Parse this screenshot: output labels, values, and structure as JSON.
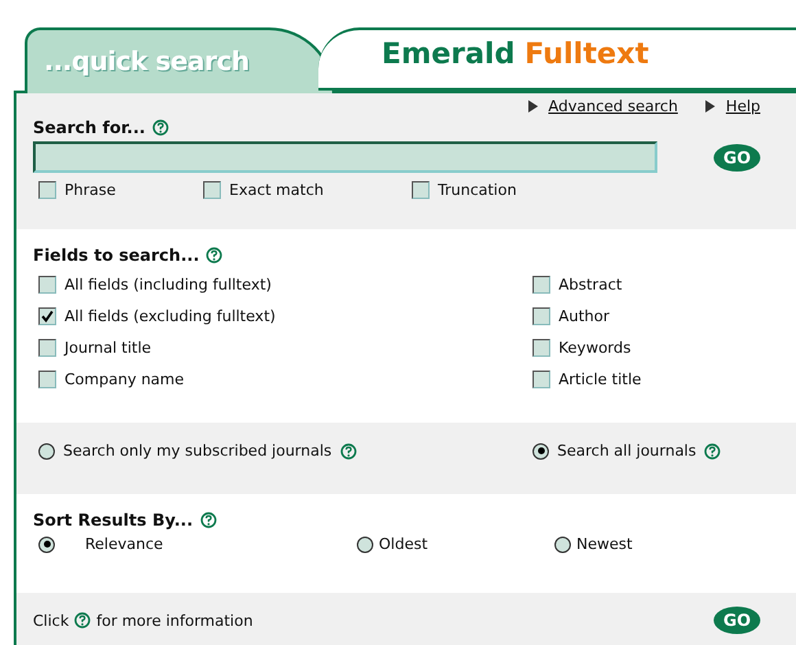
{
  "header": {
    "tab": "...quick search",
    "brand": [
      "Emerald",
      "Fulltext"
    ]
  },
  "links": [
    "Advanced search",
    "Help"
  ],
  "search": {
    "label": "Search for...",
    "go": "GO",
    "options": [
      {
        "label": "Phrase",
        "checked": false
      },
      {
        "label": "Exact match",
        "checked": false
      },
      {
        "label": "Truncation",
        "checked": false
      }
    ]
  },
  "fields": {
    "label": "Fields to search...",
    "left": [
      {
        "label": "All fields (including fulltext)",
        "checked": false
      },
      {
        "label": "All fields (excluding fulltext)",
        "checked": true
      },
      {
        "label": "Journal title",
        "checked": false
      },
      {
        "label": "Company name",
        "checked": false
      }
    ],
    "right": [
      {
        "label": "Abstract",
        "checked": false
      },
      {
        "label": "Author",
        "checked": false
      },
      {
        "label": "Keywords",
        "checked": false
      },
      {
        "label": "Article title",
        "checked": false
      }
    ]
  },
  "scope": [
    {
      "label": "Search only my subscribed journals",
      "selected": false
    },
    {
      "label": "Search all journals",
      "selected": true
    }
  ],
  "sort": {
    "label": "Sort Results By...",
    "options": [
      {
        "label": "Relevance",
        "selected": true
      },
      {
        "label": "Oldest",
        "selected": false
      },
      {
        "label": "Newest",
        "selected": false
      }
    ]
  },
  "footer": {
    "before": "Click",
    "after": "for more information",
    "go": "GO"
  }
}
